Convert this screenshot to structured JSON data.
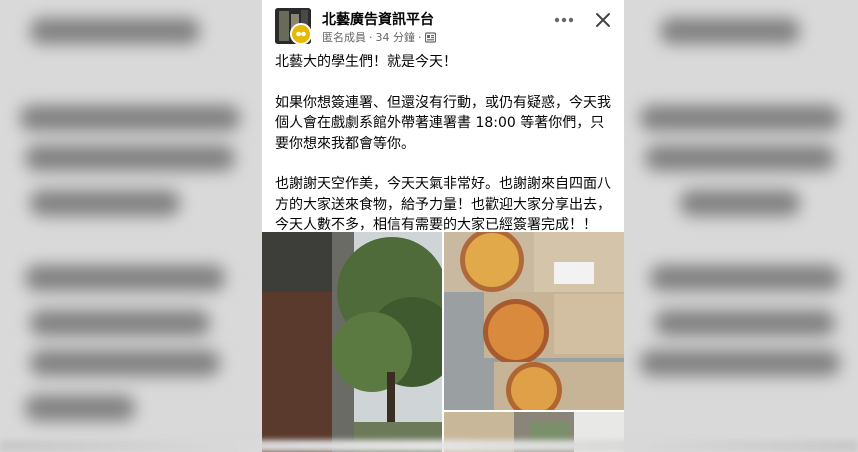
{
  "post": {
    "group_name": "北藝廣告資訊平台",
    "author_role": "匿名成員",
    "separator": "·",
    "time_ago": "34 分鐘",
    "privacy_icon": "group-icon",
    "more_icon": "more-dots-icon",
    "close_icon": "close-icon",
    "paragraphs": [
      "北藝大的學生們！就是今天！",
      "如果你想簽連署、但還沒有行動，或仍有疑惑，今天我個人會在戲劇系館外帶著連署書 18:00 等著你們，只要你想來我都會等你。",
      "也謝謝天空作美，今天天氣非常好。也謝謝來自四面八方的大家送來食物，給予力量！也歡迎大家分享出去，今天人數不多，相信有需要的大家已經簽署完成！！"
    ]
  },
  "photos": [
    {
      "name": "building-and-tree-photo"
    },
    {
      "name": "pizza-boxes-photo"
    },
    {
      "name": "food-on-ground-photo"
    }
  ],
  "colors": {
    "text_primary": "#050505",
    "text_secondary": "#65676b",
    "badge": "#e6b800",
    "background": "#d9d9d9"
  }
}
